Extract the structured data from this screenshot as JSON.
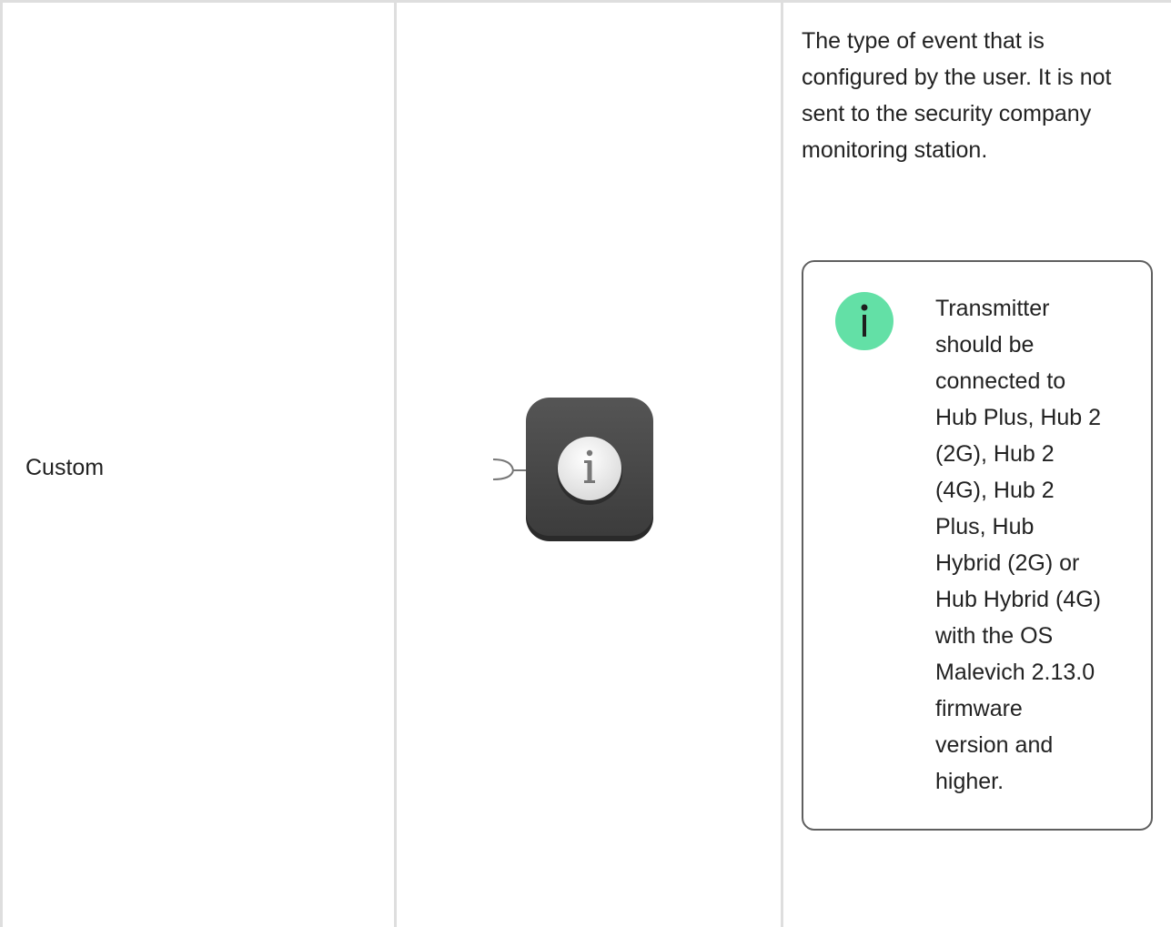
{
  "row": {
    "event_type": "Custom",
    "icon": "info-event-icon",
    "description": "The type of event that is configured by the user. It is not sent to the security company monitoring station.",
    "note": {
      "icon": "info-icon",
      "text": "Transmitter\nshould be\nconnected to\nHub Plus, Hub 2\n(2G), Hub 2\n(4G), Hub 2\nPlus, Hub\nHybrid (2G) or\nHub Hybrid (4G)\nwith the OS\nMalevich 2.13.0\nfirmware\nversion and\nhigher."
    }
  },
  "colors": {
    "border": "#dedede",
    "note_border": "#5f5f5f",
    "note_icon_bg": "#63e0a6",
    "event_icon_bg": "#4a4a4a"
  }
}
